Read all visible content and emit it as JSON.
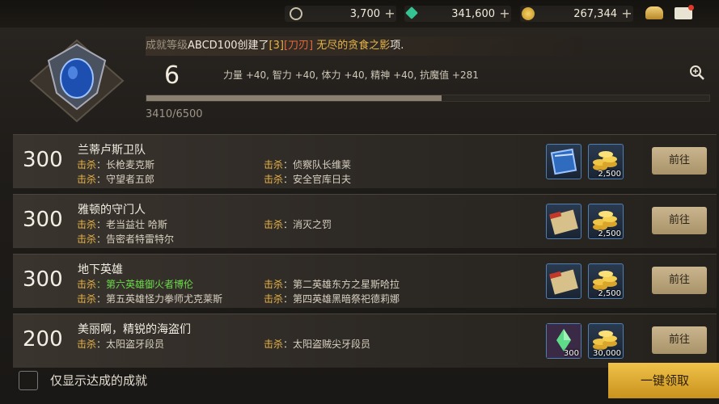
{
  "currencies": [
    {
      "icon": "c-coin-icon",
      "value": "3,700",
      "color": "#d8d0b8"
    },
    {
      "icon": "green-gem-icon",
      "value": "341,600",
      "color": "#3ec79a"
    },
    {
      "icon": "gold-coin-icon",
      "value": "267,344",
      "color": "#e8b43a"
    }
  ],
  "topbar_icons": [
    "chest-icon",
    "mail-icon"
  ],
  "header": {
    "level": "6",
    "news": {
      "prefix": "成就等级",
      "name": "ABCD100",
      "created": "创建了",
      "bracket1": "[3]",
      "bracket2": "[刀刃]",
      "item": "无尽的贪食之影",
      "suffix": "项."
    },
    "stats": "力量 +40, 智力 +40, 体力 +40, 精神 +40, 抗魔值 +281",
    "progress_text": "3410/6500",
    "progress": 0.5246
  },
  "kill_label": "击杀",
  "achievements": [
    {
      "points": "300",
      "title": "兰蒂卢斯卫队",
      "reqs": [
        {
          "text": "长枪麦克斯",
          "green": false
        },
        {
          "text": "侦察队长维莱",
          "green": false
        },
        {
          "text": "守望者五郎",
          "green": false
        },
        {
          "text": "安全官库日夫",
          "green": false
        }
      ],
      "rewards": [
        {
          "icon": "blue-film-item-icon",
          "qty": ""
        },
        {
          "icon": "gold-coins-icon",
          "qty": "2,500"
        }
      ],
      "button": "前往"
    },
    {
      "points": "300",
      "title": "雅顿的守门人",
      "reqs": [
        {
          "text": "老当益壮 哈斯",
          "green": false
        },
        {
          "text": "消灭之罚",
          "green": false
        },
        {
          "text": "告密者特雷特尔",
          "green": false
        }
      ],
      "rewards": [
        {
          "icon": "scroll-item-icon",
          "qty": ""
        },
        {
          "icon": "gold-coins-icon",
          "qty": "2,500"
        }
      ],
      "button": "前往"
    },
    {
      "points": "300",
      "title": "地下英雄",
      "reqs": [
        {
          "text": "第六英雄御火者博伦",
          "green": true
        },
        {
          "text": "第二英雄东方之星斯哈拉",
          "green": false
        },
        {
          "text": "第五英雄怪力拳师尤克莱斯",
          "green": false
        },
        {
          "text": "第四英雄黑暗祭祀德莉娜",
          "green": false
        }
      ],
      "rewards": [
        {
          "icon": "scroll-item-icon",
          "qty": ""
        },
        {
          "icon": "gold-coins-icon",
          "qty": "2,500"
        }
      ],
      "button": "前往"
    },
    {
      "points": "200",
      "title": "美丽啊，精锐的海盗们",
      "reqs": [
        {
          "text": "太阳盗牙段员",
          "green": false
        },
        {
          "text": "太阳盗贼尖牙段员",
          "green": false
        }
      ],
      "rewards": [
        {
          "icon": "green-crystal-item-icon",
          "qty": "300"
        },
        {
          "icon": "gold-coins-icon",
          "qty": "30,000"
        }
      ],
      "button": "前往"
    }
  ],
  "footer": {
    "checkbox_label": "仅显示达成的成就",
    "claim_all": "一键领取"
  }
}
